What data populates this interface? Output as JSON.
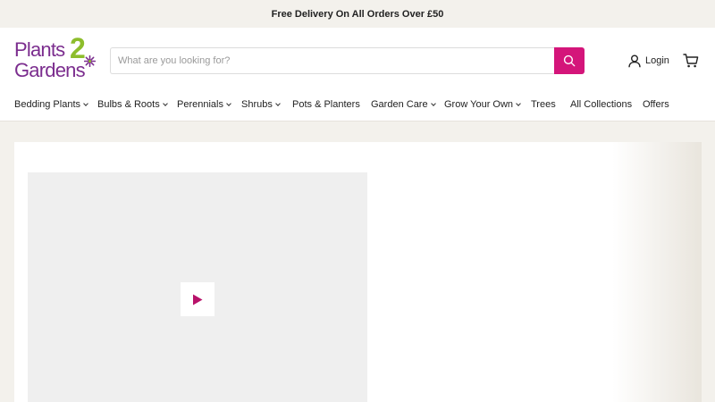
{
  "announcement": "Free Delivery On All Orders Over £50",
  "logo": {
    "line1": "Plants",
    "numeral": "2",
    "line2": "Gardens"
  },
  "search": {
    "placeholder": "What are you looking for?",
    "value": ""
  },
  "account": {
    "login_label": "Login"
  },
  "nav": [
    {
      "label": "Bedding Plants",
      "dropdown": true
    },
    {
      "label": "Bulbs & Roots",
      "dropdown": true
    },
    {
      "label": "Perennials",
      "dropdown": true
    },
    {
      "label": "Shrubs",
      "dropdown": true
    },
    {
      "label": "Pots & Planters",
      "dropdown": false
    },
    {
      "label": "Garden Care",
      "dropdown": true
    },
    {
      "label": "Grow Your Own",
      "dropdown": true
    },
    {
      "label": "Trees",
      "dropdown": false
    },
    {
      "label": "All Collections",
      "dropdown": false
    },
    {
      "label": "Offers",
      "dropdown": false
    }
  ],
  "colors": {
    "brand_purple": "#7b2d8e",
    "brand_green": "#8dbd2c",
    "accent_pink": "#d4157a",
    "page_bg": "#f3f1ec"
  },
  "icons": {
    "search": "search-icon",
    "user": "user-icon",
    "cart": "cart-icon",
    "play": "play-icon"
  }
}
